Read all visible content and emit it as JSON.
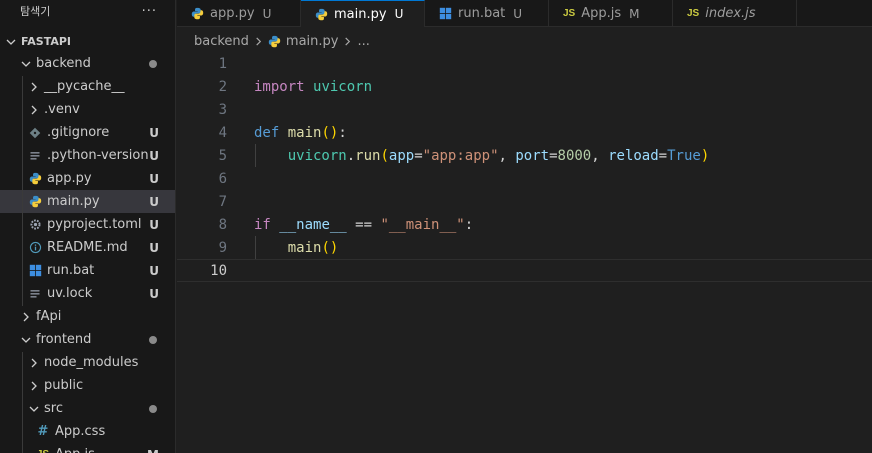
{
  "explorer": {
    "title": "탐색기",
    "more": "···",
    "root": "FASTAPI",
    "items": [
      {
        "label": "backend",
        "type": "folder-open",
        "depth": 1,
        "dot": true
      },
      {
        "label": "__pycache__",
        "type": "folder",
        "depth": 2
      },
      {
        "label": ".venv",
        "type": "folder",
        "depth": 2
      },
      {
        "label": ".gitignore",
        "type": "file",
        "icon": "git-icon",
        "depth": 2,
        "badge": "U"
      },
      {
        "label": ".python-version",
        "type": "file",
        "icon": "lines-icon",
        "depth": 2,
        "badge": "U"
      },
      {
        "label": "app.py",
        "type": "file",
        "icon": "python-icon",
        "depth": 2,
        "badge": "U"
      },
      {
        "label": "main.py",
        "type": "file",
        "icon": "python-icon",
        "depth": 2,
        "badge": "U",
        "selected": true
      },
      {
        "label": "pyproject.toml",
        "type": "file",
        "icon": "gear-icon",
        "depth": 2,
        "badge": "U"
      },
      {
        "label": "README.md",
        "type": "file",
        "icon": "info-icon",
        "depth": 2,
        "badge": "U"
      },
      {
        "label": "run.bat",
        "type": "file",
        "icon": "windows-icon",
        "depth": 2,
        "badge": "U"
      },
      {
        "label": "uv.lock",
        "type": "file",
        "icon": "lines-icon",
        "depth": 2,
        "badge": "U"
      },
      {
        "label": "fApi",
        "type": "folder",
        "depth": 1
      },
      {
        "label": "frontend",
        "type": "folder-open",
        "depth": 1,
        "dot": true
      },
      {
        "label": "node_modules",
        "type": "folder",
        "depth": 2
      },
      {
        "label": "public",
        "type": "folder",
        "depth": 2
      },
      {
        "label": "src",
        "type": "folder-open",
        "depth": 2,
        "dot": true
      },
      {
        "label": "App.css",
        "type": "file",
        "icon": "hash-icon",
        "depth": 3
      },
      {
        "label": "App.js",
        "type": "file",
        "icon": "js-icon",
        "depth": 3,
        "badge": "M"
      }
    ]
  },
  "tabs": [
    {
      "label": "app.py",
      "icon": "python-icon",
      "status": "U",
      "active": false
    },
    {
      "label": "main.py",
      "icon": "python-icon",
      "status": "U",
      "active": true
    },
    {
      "label": "run.bat",
      "icon": "windows-icon",
      "status": "U",
      "active": false
    },
    {
      "label": "App.js",
      "icon": "js-icon",
      "status": "M",
      "active": false
    },
    {
      "label": "index.js",
      "icon": "js-icon",
      "status": "",
      "active": false,
      "italic": true
    }
  ],
  "breadcrumb": {
    "folder": "backend",
    "file": "main.py",
    "ellipsis": "..."
  },
  "editor": {
    "current_line": 10,
    "line_numbers": [
      "1",
      "2",
      "3",
      "4",
      "5",
      "6",
      "7",
      "8",
      "9",
      "10"
    ],
    "code": {
      "l2_import": "import",
      "l2_module": "uvicorn",
      "l4_def": "def",
      "l4_name": "main",
      "l4_parens": "()",
      "l4_colon": ":",
      "l5_obj": "uvicorn",
      "l5_dot": ".",
      "l5_fn": "run",
      "l5_open": "(",
      "l5_k1": "app",
      "l5_eq1": "=",
      "l5_v1": "\"app:app\"",
      "l5_c1": ", ",
      "l5_k2": "port",
      "l5_eq2": "=",
      "l5_v2": "8000",
      "l5_c2": ", ",
      "l5_k3": "reload",
      "l5_eq3": "=",
      "l5_v3": "True",
      "l5_close": ")",
      "l8_if": "if",
      "l8_name": "__name__",
      "l8_eq": " == ",
      "l8_str": "\"__main__\"",
      "l8_colon": ":",
      "l9_call": "main",
      "l9_parens": "()"
    }
  }
}
